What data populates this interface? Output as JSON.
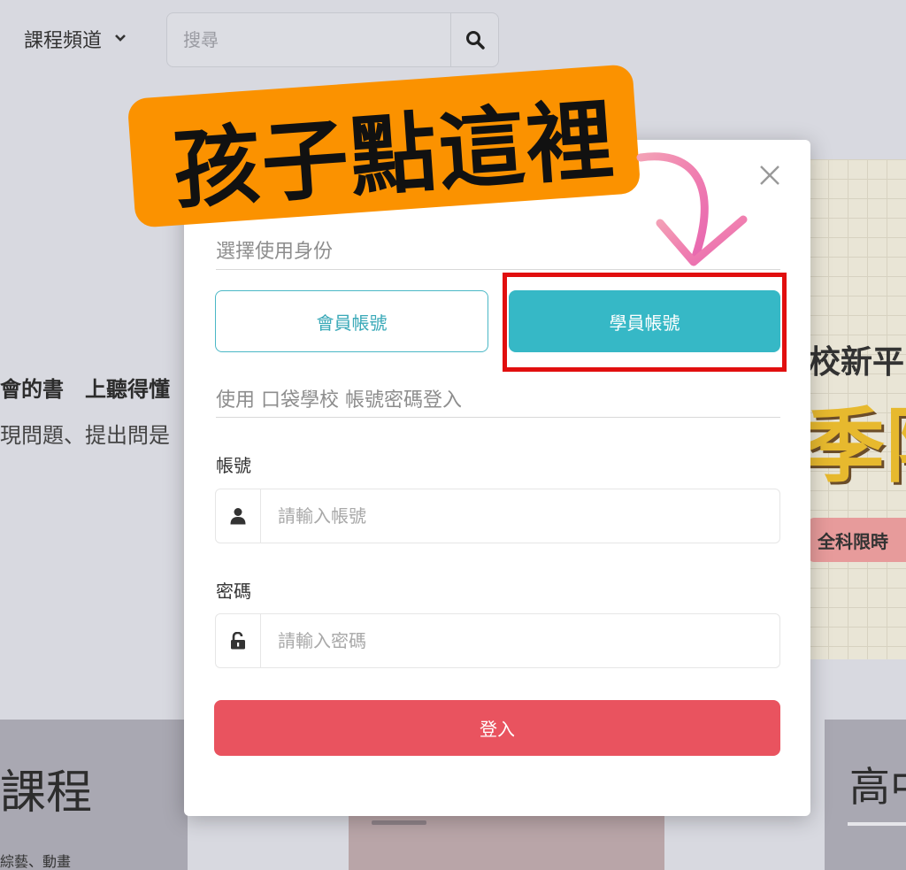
{
  "header": {
    "channel_label": "課程頻道",
    "search_placeholder": "搜尋"
  },
  "background": {
    "line1": "會的書　上聽得懂",
    "line2": "現問題、提出問是",
    "banner": {
      "line1": "校新平",
      "line2": "季限",
      "pill": "全科限時"
    },
    "card_left_title": "課程",
    "card_left_sub": "綜藝、動畫",
    "card_right_title": "高中"
  },
  "modal": {
    "role_section": "選擇使用身份",
    "member_button": "會員帳號",
    "student_button": "學員帳號",
    "login_with": "使用 口袋學校 帳號密碼登入",
    "account_label": "帳號",
    "account_placeholder": "請輸入帳號",
    "password_label": "密碼",
    "password_placeholder": "請輸入密碼",
    "login_button": "登入"
  },
  "annotation": {
    "callout_text": "孩子點這裡",
    "callout_color": "#fb9200",
    "highlight_color": "#e10f0f"
  },
  "icons": [
    "chevron-down-icon",
    "search-icon",
    "close-icon",
    "user-icon",
    "unlock-icon"
  ],
  "colors": {
    "accent_teal": "#36b8c6",
    "login_red": "#e9535f"
  }
}
